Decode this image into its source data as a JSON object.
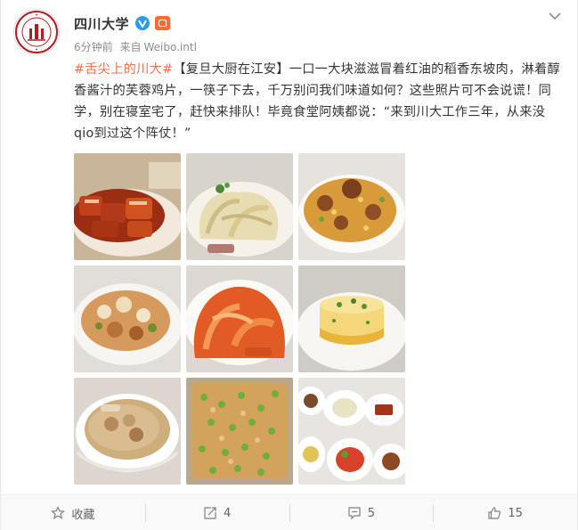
{
  "user": {
    "name": "四川大学",
    "avatar_icon": "sichuan-university-seal",
    "verified_icon": "verified-badge-icon",
    "level_icon": "member-level-icon"
  },
  "meta": {
    "time": "6分钟前",
    "source_prefix": "来自",
    "source": "Weibo.intl"
  },
  "post": {
    "topic": "#舌尖上的川大#",
    "body": "【复旦大厨在江安】一口一大块滋滋冒着红油的稻香东坡肉，淋着醇香酱汁的芙蓉鸡片，一筷子下去，千万别问我们味道如何？这些照片可不会说谎！同学，别在寝室宅了，赶快来排队！毕竟食堂阿姨都说：“来到川大工作三年，从来没qio到过这个阵仗！”"
  },
  "images": [
    {
      "name": "photo-braised-pork",
      "subject": "稻香东坡肉"
    },
    {
      "name": "photo-chicken-slices",
      "subject": "芙蓉鸡片"
    },
    {
      "name": "photo-fried-rice",
      "subject": "fried rice"
    },
    {
      "name": "photo-stir-fry",
      "subject": "stir fry"
    },
    {
      "name": "photo-tomato-dish",
      "subject": "tomato dish"
    },
    {
      "name": "photo-egg-pudding",
      "subject": "egg dish"
    },
    {
      "name": "photo-soup",
      "subject": "soup"
    },
    {
      "name": "photo-peas-rice",
      "subject": "rice with peas"
    },
    {
      "name": "photo-dish-spread",
      "subject": "dishes"
    }
  ],
  "actions": {
    "favorite_label": "收藏",
    "repost_count": "4",
    "comment_count": "5",
    "like_count": "15"
  },
  "colors": {
    "topic": "#eb7350",
    "verified": "#2a9bf0",
    "text": "#333333",
    "meta": "#8e8e8e"
  }
}
